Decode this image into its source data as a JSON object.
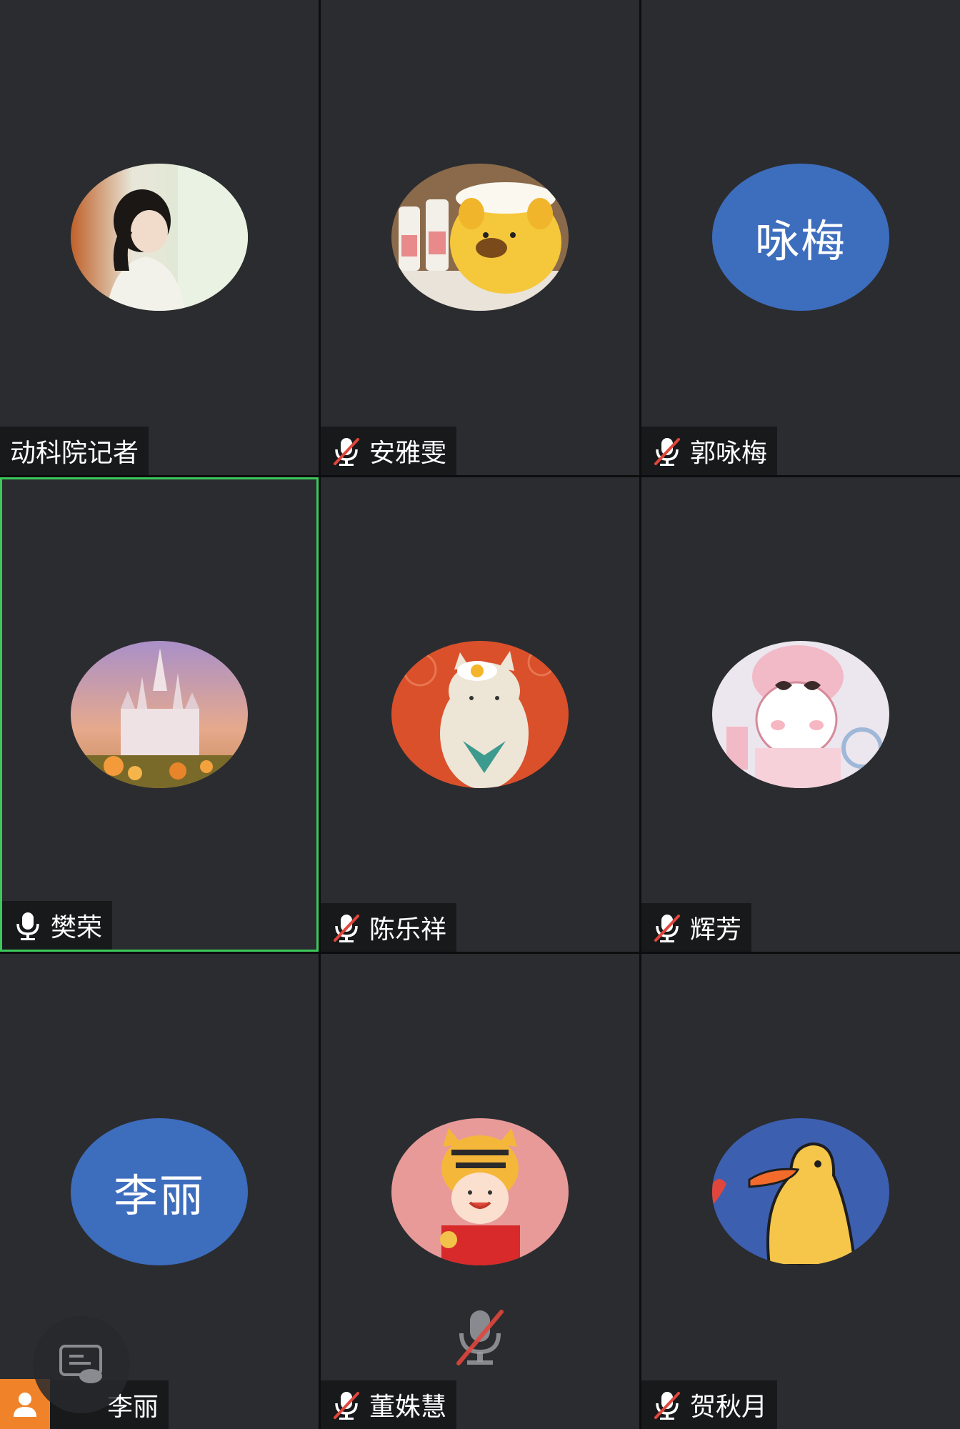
{
  "participants": [
    {
      "name": "动科院记者",
      "mic": "none",
      "avatar": "photo-woman-window"
    },
    {
      "name": "安雅雯",
      "mic": "muted",
      "avatar": "photo-yellow-bear"
    },
    {
      "name": "郭咏梅",
      "mic": "muted",
      "avatar_text": "咏梅"
    },
    {
      "name": "樊荣",
      "mic": "on",
      "avatar": "photo-castle",
      "active_speaker": true
    },
    {
      "name": "陈乐祥",
      "mic": "muted",
      "avatar": "illustration-cat-egg"
    },
    {
      "name": "辉芳",
      "mic": "muted",
      "avatar": "illustration-pink-bunny"
    },
    {
      "name": "李丽",
      "mic": "none",
      "avatar_text": "李丽"
    },
    {
      "name": "董姝慧",
      "mic": "muted",
      "avatar": "illustration-tiger-girl"
    },
    {
      "name": "贺秋月",
      "mic": "muted",
      "avatar": "illustration-yellow-duck"
    }
  ],
  "colors": {
    "tile_bg": "#2b2c30",
    "name_tag_bg": "#18191b",
    "text_avatar_bg": "#3d6dbd",
    "active_border": "#3cc85a",
    "muted_slash": "#e0463c",
    "user_chip": "#f0832a"
  },
  "icons": {
    "muted": "mic-muted-icon",
    "on": "mic-icon",
    "overlay": "chat-bubble-icon",
    "self": "user-icon"
  }
}
